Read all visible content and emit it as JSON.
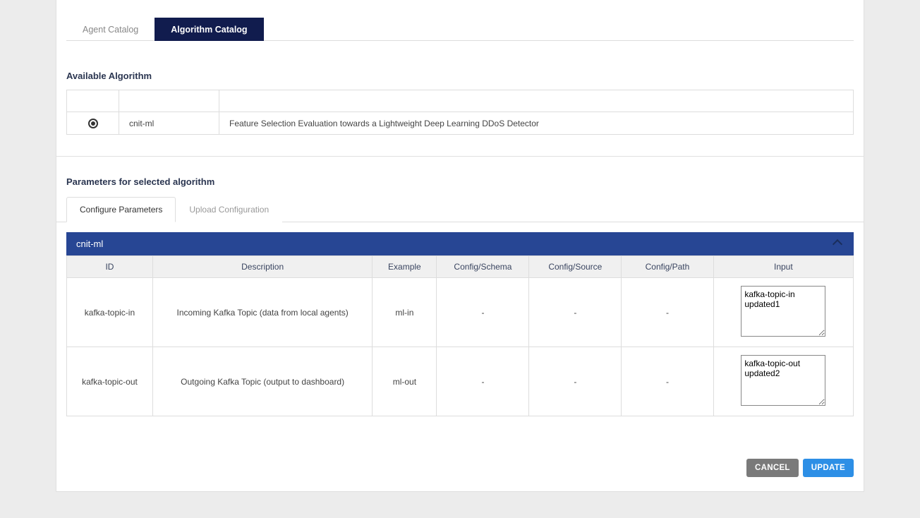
{
  "tabs": {
    "agent": "Agent Catalog",
    "algorithm": "Algorithm Catalog"
  },
  "sections": {
    "available_heading": "Available Algorithm",
    "params_heading": "Parameters for selected algorithm"
  },
  "algorithms": [
    {
      "selected": true,
      "name": "cnit-ml",
      "description": "Feature Selection Evaluation towards a Lightweight Deep Learning DDoS Detector"
    }
  ],
  "param_tabs": {
    "configure": "Configure Parameters",
    "upload": "Upload Configuration"
  },
  "accordion": {
    "title": "cnit-ml"
  },
  "param_columns": {
    "id": "ID",
    "description": "Description",
    "example": "Example",
    "schema": "Config/Schema",
    "source": "Config/Source",
    "path": "Config/Path",
    "input": "Input"
  },
  "params": [
    {
      "id": "kafka-topic-in",
      "description": "Incoming Kafka Topic (data from local agents)",
      "example": "ml-in",
      "schema": "-",
      "source": "-",
      "path": "-",
      "input": "kafka-topic-in updated1"
    },
    {
      "id": "kafka-topic-out",
      "description": "Outgoing Kafka Topic (output to dashboard)",
      "example": "ml-out",
      "schema": "-",
      "source": "-",
      "path": "-",
      "input": "kafka-topic-out updated2"
    }
  ],
  "buttons": {
    "cancel": "CANCEL",
    "update": "UPDATE"
  }
}
